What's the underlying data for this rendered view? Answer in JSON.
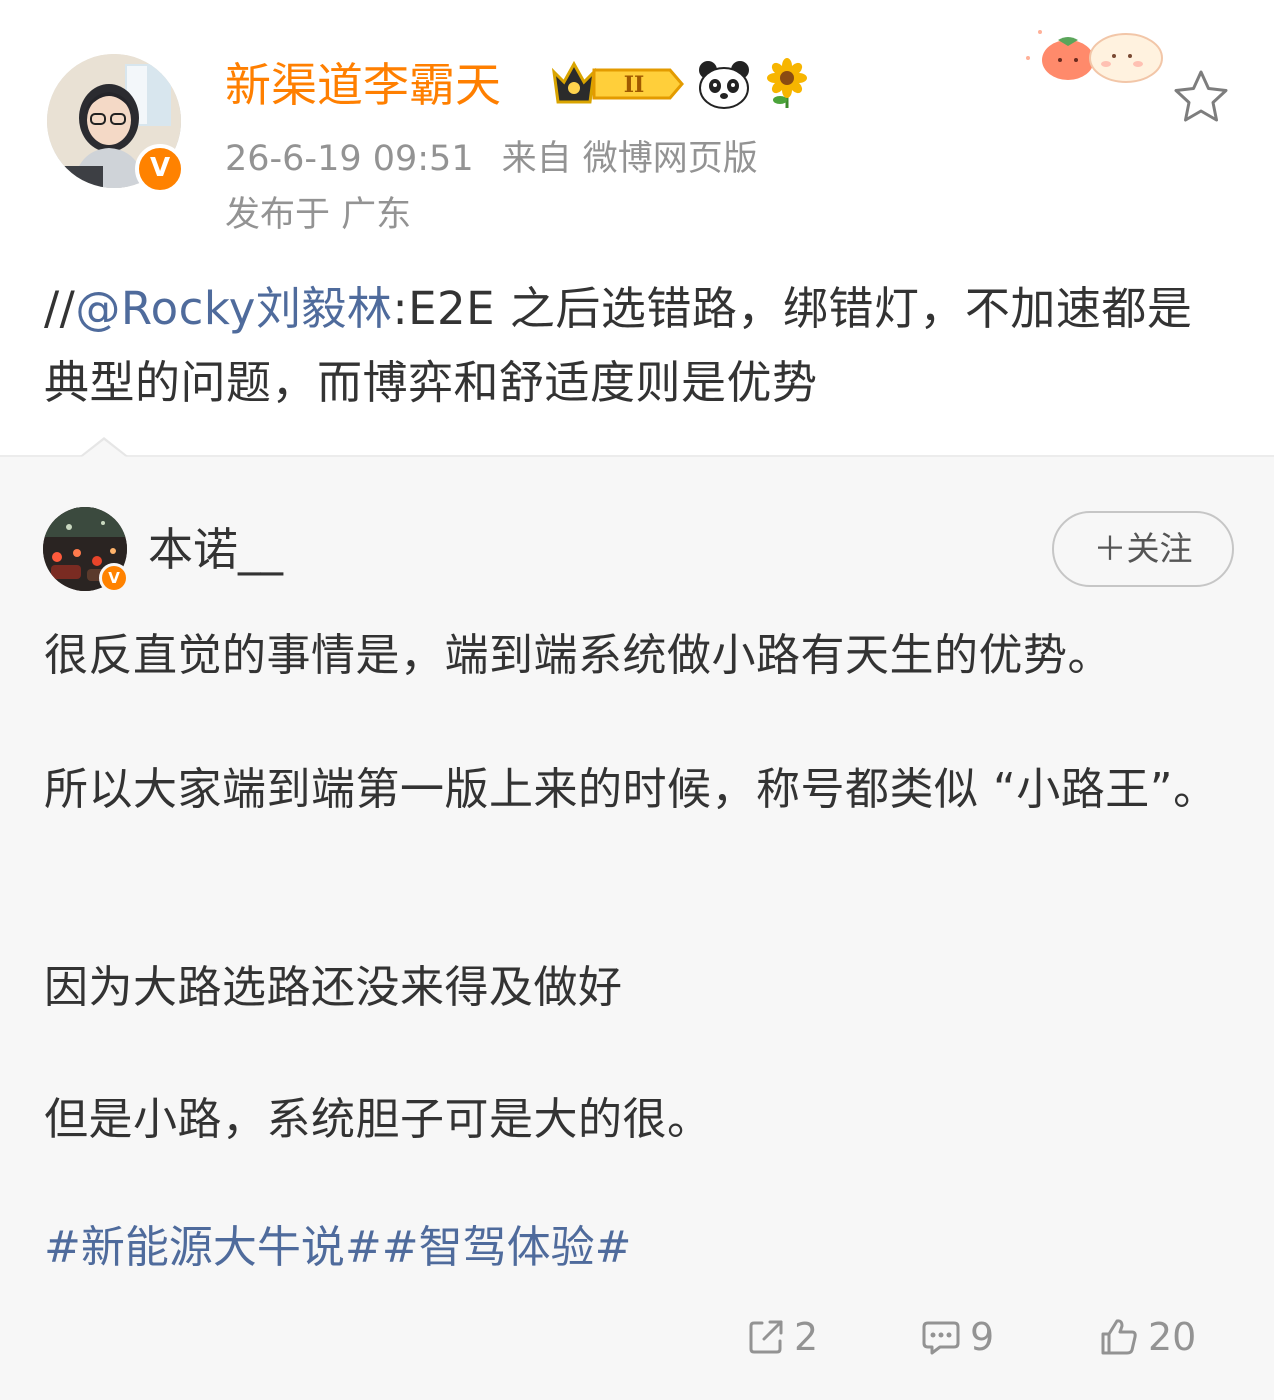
{
  "post": {
    "author": "新渠道李霸天",
    "timestamp": "26-6-19 09:51",
    "source": "来自 微博网页版",
    "location": "发布于 广东",
    "repost_prefix": "//",
    "mention": "@Rocky刘毅林",
    "repost_text": ":E2E 之后选错路，绑错灯，不加速都是典型的问题，而博弈和舒适度则是优势",
    "badges": [
      "crown-level-badge",
      "panda-emoji",
      "sunflower-emoji"
    ],
    "crown_level": "II"
  },
  "original": {
    "author": "本诺__",
    "follow_label": "＋关注",
    "paragraphs": [
      "很反直觉的事情是，端到端系统做小路有天生的优势。",
      "所以大家端到端第一版上来的时候，称号都类似 “小路王”。",
      "因为大路选路还没来得及做好",
      "但是小路，系统胆子可是大的很。"
    ],
    "hashtags": [
      "#新能源大牛说#",
      "#智驾体验#"
    ]
  },
  "actions": {
    "reposts": "2",
    "comments": "9",
    "likes": "20"
  },
  "colors": {
    "author_orange": "#ff7f00",
    "link_blue": "#4f6b9c",
    "meta_gray": "#939393",
    "text_dark": "#333333",
    "retweet_bg": "#f7f7f7",
    "verified_orange": "#ff8200"
  },
  "icons": {
    "verified": "V"
  }
}
